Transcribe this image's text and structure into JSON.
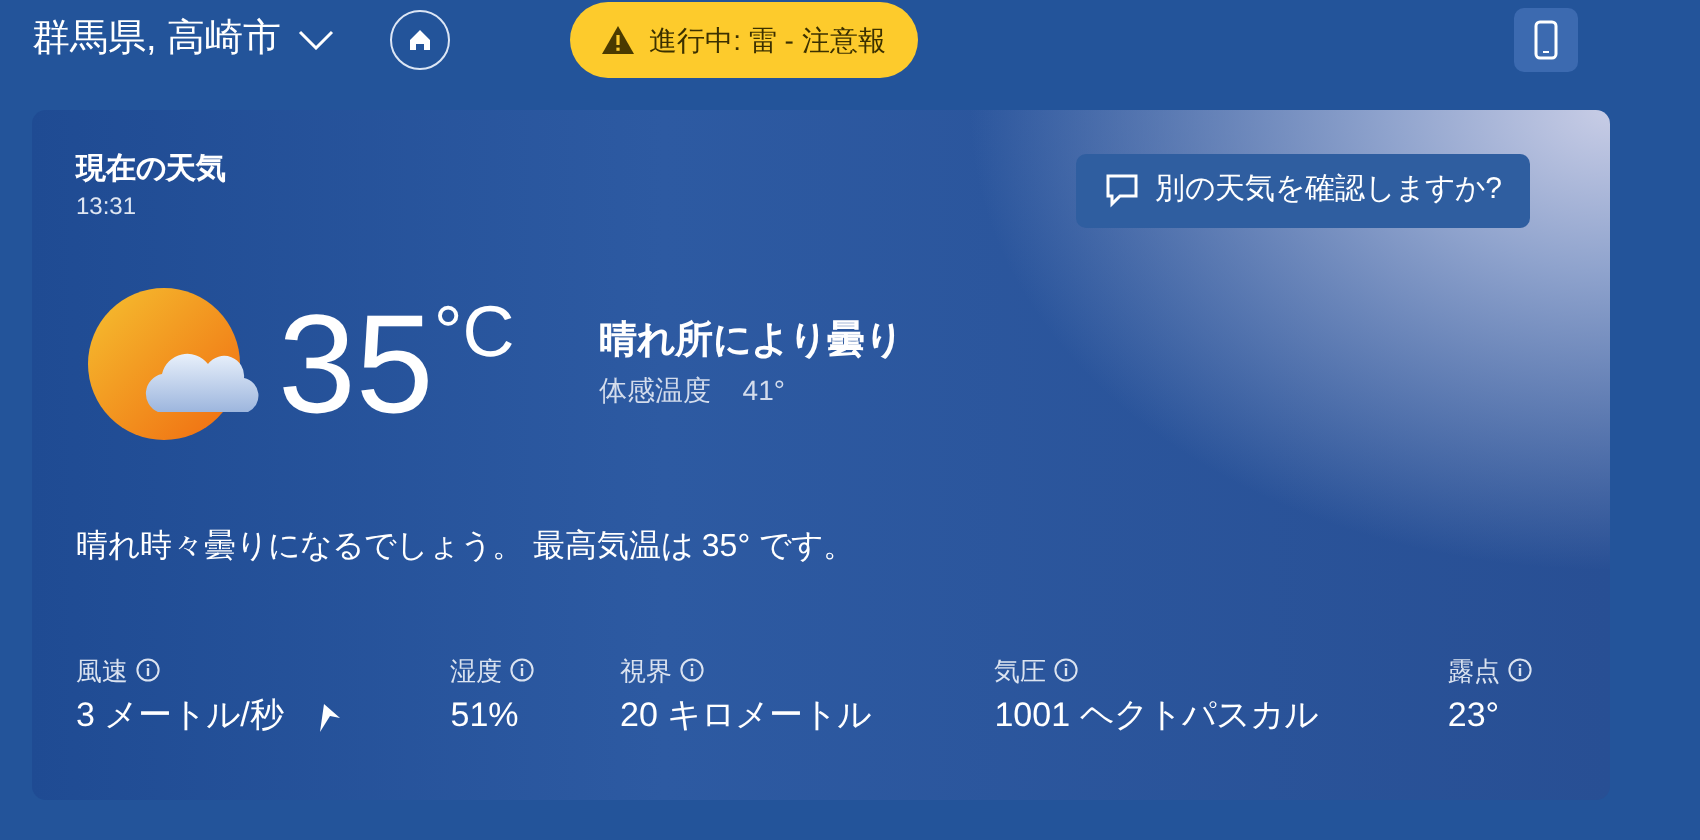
{
  "header": {
    "location": "群馬県, 高崎市",
    "alert": "進行中: 雷 - 注意報"
  },
  "current": {
    "title": "現在の天気",
    "time": "13:31",
    "ask_button": "別の天気を確認しますか?",
    "temperature": "35",
    "unit": "°C",
    "condition": "晴れ所により曇り",
    "feels_label": "体感温度",
    "feels_value": "41°",
    "summary": "晴れ時々曇りになるでしょう。 最高気温は 35° です。"
  },
  "details": [
    {
      "label": "風速",
      "value": "3 メートル/秒",
      "kind": "wind"
    },
    {
      "label": "湿度",
      "value": "51%",
      "kind": "plain"
    },
    {
      "label": "視界",
      "value": "20 キロメートル",
      "kind": "plain"
    },
    {
      "label": "気圧",
      "value": "1001 ヘクトパスカル",
      "kind": "plain"
    },
    {
      "label": "露点",
      "value": "23°",
      "kind": "plain"
    }
  ]
}
